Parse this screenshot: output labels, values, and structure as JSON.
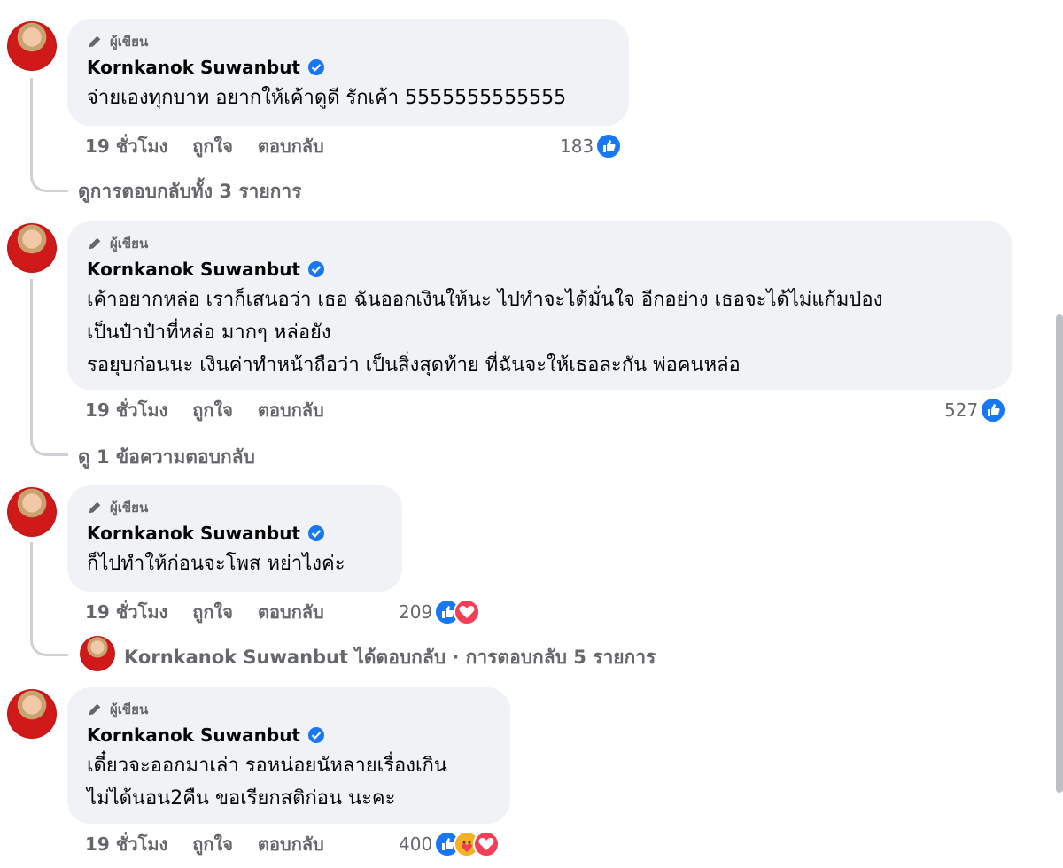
{
  "comments": [
    {
      "author_tag": "ผู้เขียน",
      "name": "Kornkanok Suwanbut",
      "lines": [
        "จ่ายเองทุกบาท อยากให้เค้าดูดี รักเค้า 5555555555555"
      ],
      "time": "19 ชั่วโมง",
      "like_label": "ถูกใจ",
      "reply_label": "ตอบกลับ",
      "reaction_count": "183",
      "reactions": [
        "like-icon"
      ],
      "view_replies": "ดูการตอบกลับทั้ง 3 รายการ"
    },
    {
      "author_tag": "ผู้เขียน",
      "name": "Kornkanok Suwanbut",
      "lines": [
        "เค้าอยากหล่อ เราก็เสนอว่า เธอ ฉันออกเงินให้นะ ไปทำจะได้มั่นใจ อีกอย่าง เธอจะได้ไม่แก้มป่อง",
        "เป็นป๋าป๋าที่หล่อ มากๆ หล่อยัง",
        "รอยุบก่อนนะ เงินค่าทำหน้าถือว่า เป็นสิ่งสุดท้าย ที่ฉันจะให้เธอละกัน พ่อคนหล่อ"
      ],
      "time": "19 ชั่วโมง",
      "like_label": "ถูกใจ",
      "reply_label": "ตอบกลับ",
      "reaction_count": "527",
      "reactions": [
        "like-icon"
      ],
      "view_replies": "ดู 1 ข้อความตอบกลับ"
    },
    {
      "author_tag": "ผู้เขียน",
      "name": "Kornkanok Suwanbut",
      "lines": [
        "ก็ไปทำให้ก่อนจะโพส หย่าไงค่ะ"
      ],
      "time": "19 ชั่วโมง",
      "like_label": "ถูกใจ",
      "reply_label": "ตอบกลับ",
      "reaction_count": "209",
      "reactions": [
        "like-icon",
        "love-icon"
      ],
      "reply_summary": "Kornkanok Suwanbut ได้ตอบกลับ · การตอบกลับ 5 รายการ"
    },
    {
      "author_tag": "ผู้เขียน",
      "name": "Kornkanok Suwanbut",
      "lines": [
        "เดี๋ยวจะออกมาเล่า รอหน่อยนัหลายเรื่องเกิน",
        "ไม่ได้นอน2คืน ขอเรียกสติก่อน นะคะ"
      ],
      "time": "19 ชั่วโมง",
      "like_label": "ถูกใจ",
      "reply_label": "ตอบกลับ",
      "reaction_count": "400",
      "reactions": [
        "like-icon",
        "care-icon",
        "love-icon"
      ]
    }
  ],
  "colors": {
    "bubble": "#f0f2f5",
    "secondary_text": "#65676b",
    "verified": "#1877f2",
    "like": "#1877f2",
    "love": "#f33e58",
    "care": "#f7b125"
  }
}
